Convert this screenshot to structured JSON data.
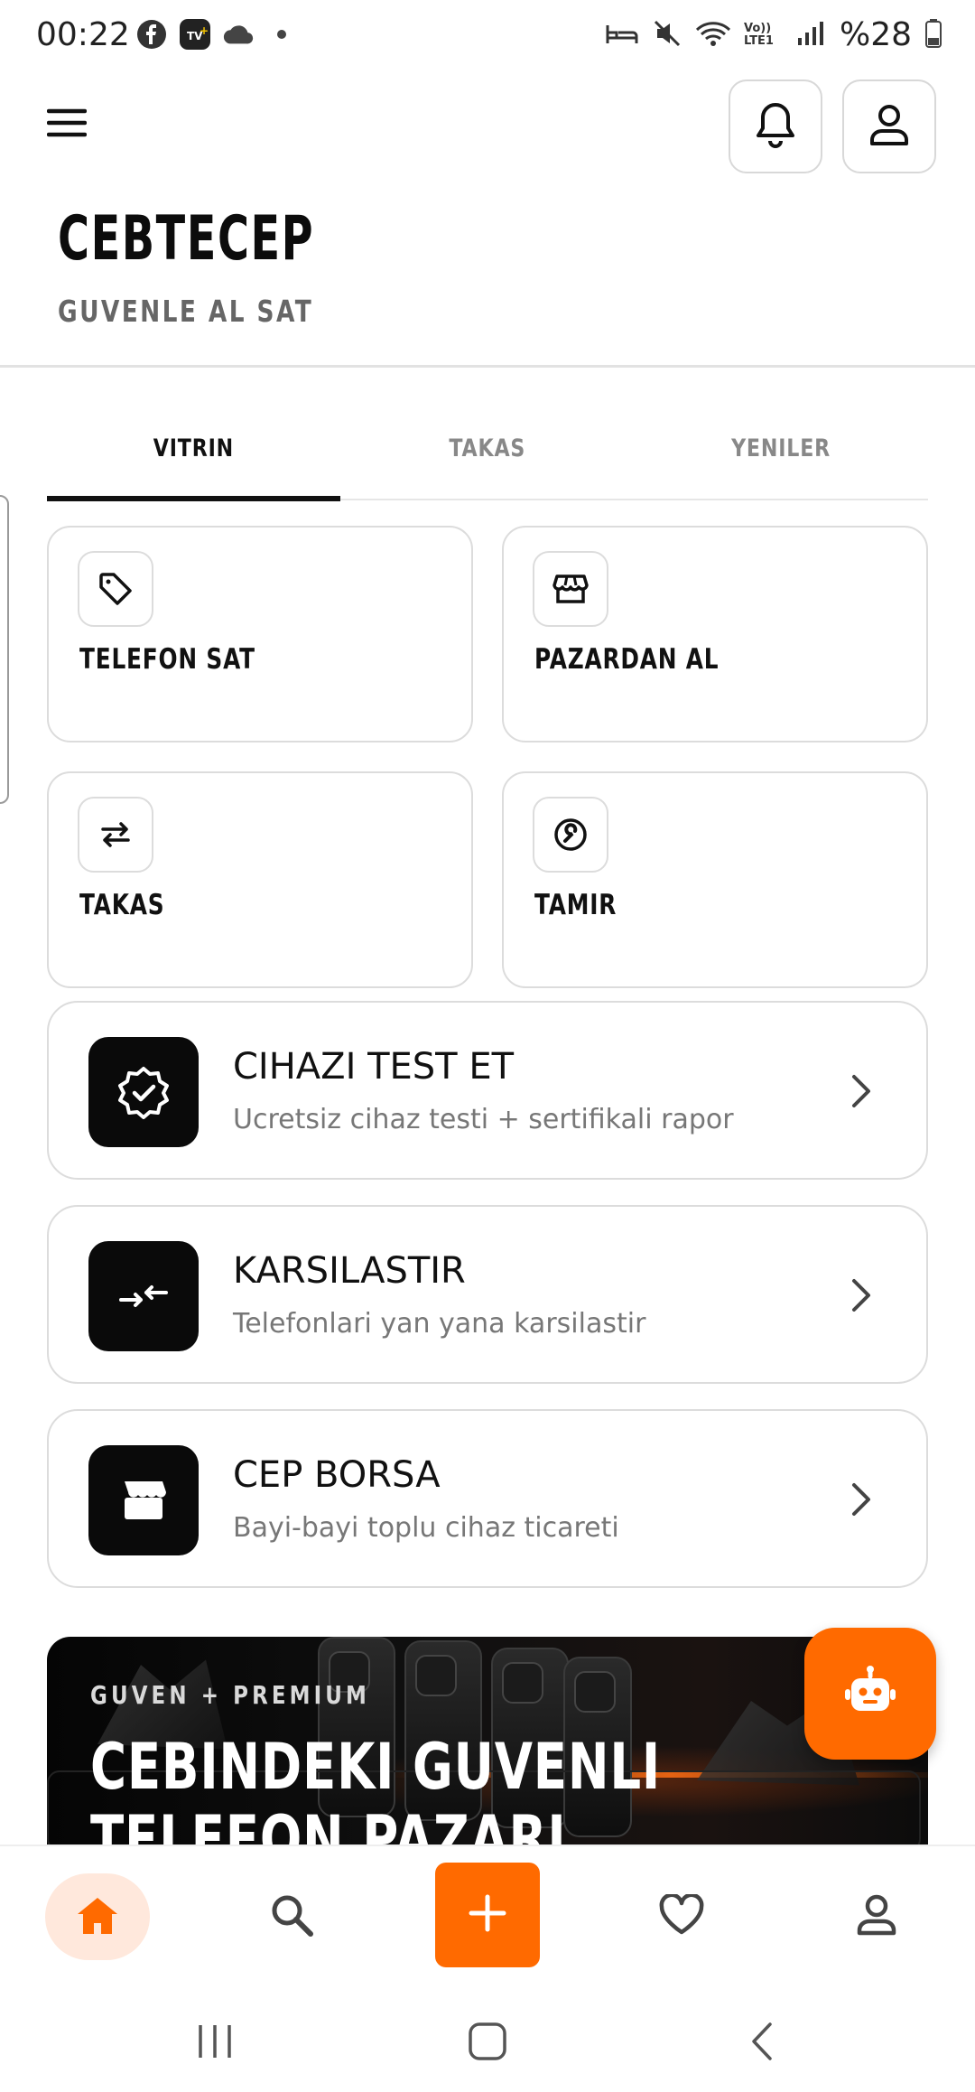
{
  "status_bar": {
    "time": "00:22",
    "battery_text": "%28",
    "left_icons": [
      "facebook-icon",
      "tv-plus-icon",
      "cloud-icon",
      "dot-icon"
    ],
    "right_icons": [
      "sleep-icon",
      "mute-icon",
      "wifi-icon",
      "volte-icon",
      "signal-icon",
      "battery-icon"
    ],
    "volte_label": "Vo)) LTE1"
  },
  "header": {
    "brand": "CEBTECEP",
    "tagline": "GUVENLE AL SAT",
    "icons": [
      "menu-icon",
      "bell-icon",
      "user-icon"
    ]
  },
  "tabs": [
    {
      "label": "VITRIN",
      "active": true
    },
    {
      "label": "TAKAS",
      "active": false
    },
    {
      "label": "YENILER",
      "active": false
    }
  ],
  "grid_cards": [
    {
      "label": "TELEFON SAT",
      "icon": "tag-icon"
    },
    {
      "label": "PAZARDAN AL",
      "icon": "store-icon"
    },
    {
      "label": "TAKAS",
      "icon": "swap-icon"
    },
    {
      "label": "TAMIR",
      "icon": "wrench-icon"
    }
  ],
  "list_cards": [
    {
      "title": "CIHAZI TEST ET",
      "subtitle": "Ucretsiz cihaz testi + sertifikali rapor",
      "icon": "verified-badge-icon"
    },
    {
      "title": "KARSILASTIR",
      "subtitle": "Telefonlari yan yana karsilastir",
      "icon": "compare-icon"
    },
    {
      "title": "CEP BORSA",
      "subtitle": "Bayi-bayi toplu cihaz ticareti",
      "icon": "store-icon"
    }
  ],
  "banner": {
    "kicker": "GUVEN + PREMIUM",
    "headline_line1": "CEBINDEKI GUVENLI",
    "headline_line2": "TELEFON PAZARI"
  },
  "fab": {
    "icon": "robot-icon"
  },
  "bottom_nav": [
    {
      "name": "home",
      "icon": "home-icon",
      "active": true
    },
    {
      "name": "search",
      "icon": "search-icon",
      "active": false
    },
    {
      "name": "add",
      "icon": "plus-icon",
      "active": false
    },
    {
      "name": "favorites",
      "icon": "heart-icon",
      "active": false
    },
    {
      "name": "profile",
      "icon": "user-icon",
      "active": false
    }
  ],
  "colors": {
    "accent": "#ff6a00",
    "accent_soft": "#ffe8dc",
    "text_primary": "#111111",
    "text_secondary": "#777777",
    "border": "#dcdcdc"
  }
}
